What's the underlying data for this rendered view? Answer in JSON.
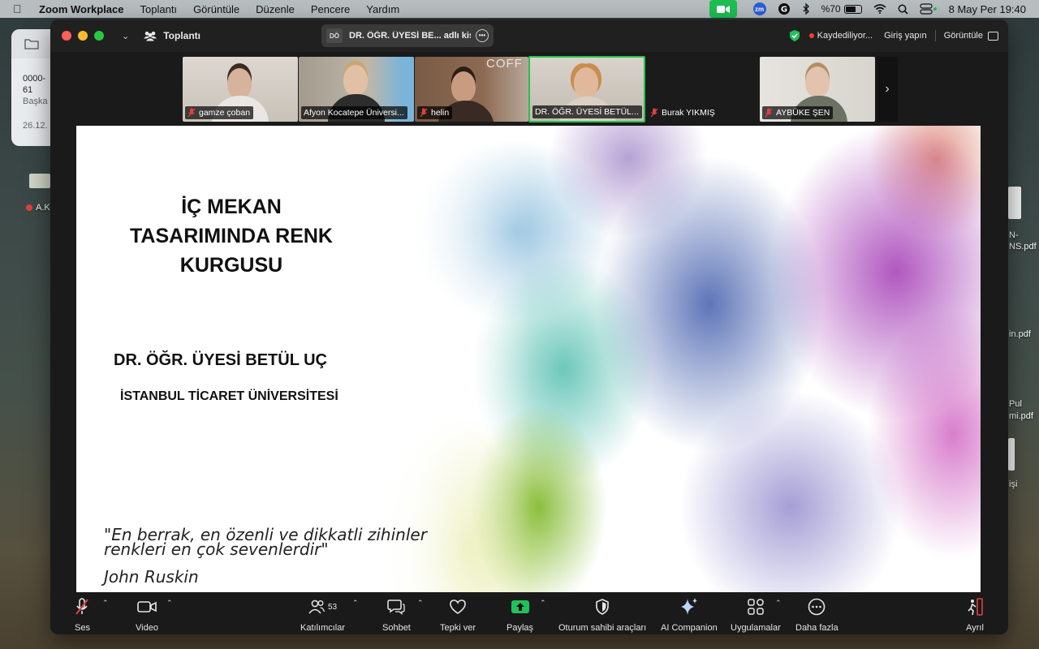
{
  "menubar": {
    "app_name": "Zoom Workplace",
    "menus": [
      "Toplantı",
      "Görüntüle",
      "Düzenle",
      "Pencere",
      "Yardım"
    ],
    "zm_badge": "zm",
    "battery_text": "%70",
    "battery_level": 0.7,
    "clock": "8 May Per  19:40"
  },
  "desktop": {
    "bg_window_lines": [
      "0000-",
      "61",
      "Başka",
      "26.12."
    ],
    "label_left": "A.K",
    "file_labels": [
      "N-",
      "NS.pdf",
      "in.pdf",
      "Pul",
      "mi.pdf",
      "işi"
    ]
  },
  "titlebar": {
    "meeting_label": "Toplantı",
    "speaker_initials": "DÖ",
    "speaker_pill": "DR. ÖĞR. ÜYESİ BE... adlı kişi",
    "recording_text": "Kaydediliyor...",
    "signin": "Giriş yapın",
    "view": "Görüntüle"
  },
  "thumbnails": [
    {
      "name": "gamze çoban",
      "muted": true
    },
    {
      "name": "Afyon Kocatepe Üniversi...",
      "muted": false
    },
    {
      "name": "helin",
      "muted": true
    },
    {
      "name": "DR. ÖĞR. ÜYESİ BETÜL...",
      "muted": false,
      "active": true
    },
    {
      "name": "Burak YIKMIŞ",
      "muted": true
    },
    {
      "name": "AYBÜKE ŞEN",
      "muted": true
    }
  ],
  "thumb_decor": {
    "coffee_sign": "COFF"
  },
  "slide": {
    "title_lines": [
      "İÇ MEKAN",
      "TASARIMINDA RENK",
      "KURGUSU"
    ],
    "author": "DR. ÖĞR. ÜYESİ BETÜL UÇ",
    "institution": "İSTANBUL TİCARET ÜNİVERSİTESİ",
    "quote_lines": [
      "\"En berrak, en özenli ve dikkatli zihinler",
      "renkleri en çok sevenlerdir\""
    ],
    "quote_author": "John Ruskin"
  },
  "controls": {
    "audio": "Ses",
    "video": "Video",
    "participants": "Katılımcılar",
    "participants_count": "53",
    "chat": "Sohbet",
    "react": "Tepki ver",
    "share": "Paylaş",
    "host_tools": "Oturum sahibi araçları",
    "ai": "AI Companion",
    "apps": "Uygulamalar",
    "more": "Daha fazla",
    "leave": "Ayrıl"
  },
  "colors": {
    "active_speaker": "#27c24c",
    "share_green": "#21c25a",
    "muted_red": "#e0413a",
    "leave_red": "#e0413a"
  }
}
